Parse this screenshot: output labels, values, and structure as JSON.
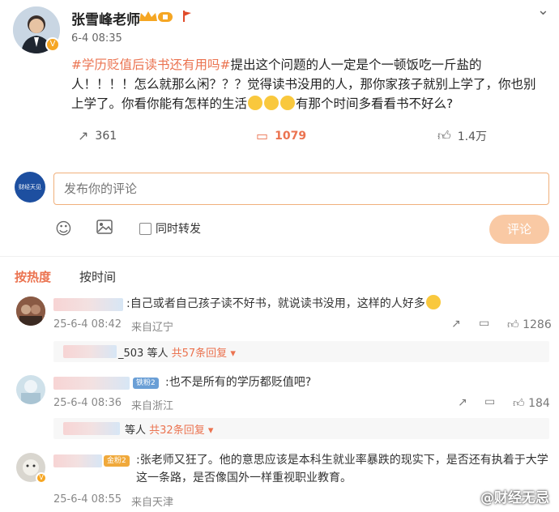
{
  "post": {
    "author": "张雪峰老师",
    "time": "6-4 08:35",
    "topic": "#学历贬值后读书还有用吗#",
    "text_1": "提出这个问题的人一定是个一顿饭吃一斤盐的人！！！！怎么就那么闲？？？觉得读书没用的人，那你家孩子就别上学了，你也别上学了。你看你能有怎样的生活",
    "text_2": "有那个时间多看看书不好么?",
    "shares": "361",
    "comments": "1079",
    "likes": "1.4万"
  },
  "composer": {
    "placeholder": "发布你的评论",
    "repost_label": "同时转发",
    "submit_label": "评论",
    "brand_avatar_text": "财经天见"
  },
  "sort": {
    "hot": "按热度",
    "time": "按时间"
  },
  "comments": [
    {
      "text": ":自己或者自己孩子读不好书，就说读书没用，这样的人好多",
      "time": "25-6-4 08:42",
      "location": "来自辽宁",
      "likes": "1286",
      "reply_user_suffix": "_503",
      "reply_others": "等人",
      "reply_link": "共57条回复"
    },
    {
      "badge": "铁粉2",
      "text": ":也不是所有的学历都贬值吧?",
      "time": "25-6-4 08:36",
      "location": "来自浙江",
      "likes": "184",
      "reply_others": "等人",
      "reply_link": "共32条回复"
    },
    {
      "badge": "金粉2",
      "text": ":张老师又狂了。他的意思应该是本科生就业率暴跌的现实下，是否还有执着于大学这一条路，是否像国外一样重视职业教育。",
      "time": "25-6-4 08:55",
      "location": "来自天津"
    }
  ],
  "watermark": "@财经无忌",
  "colors": {
    "accent": "#eb7350",
    "button_disabled": "#f9c9a4",
    "input_border": "#f0b07c"
  }
}
